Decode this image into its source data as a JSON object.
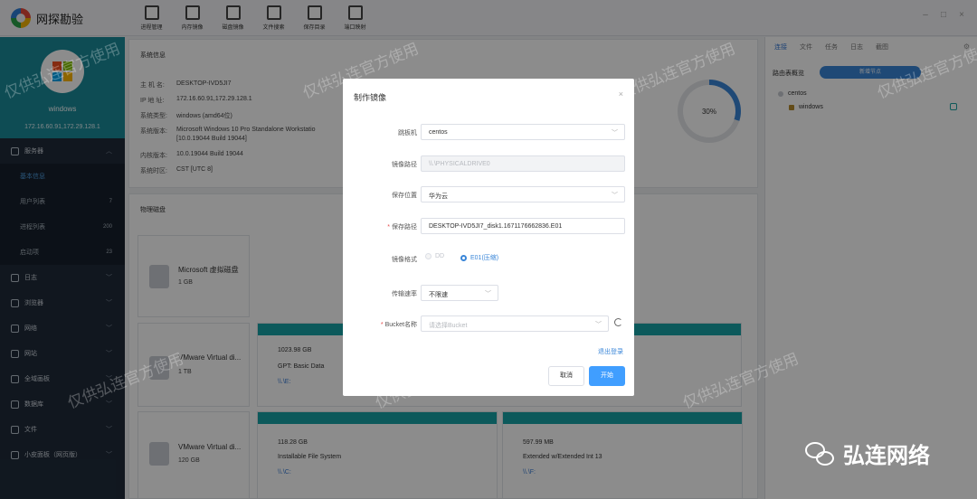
{
  "app": {
    "title": "网探勘验"
  },
  "toolbar": [
    {
      "label": "进程管理",
      "icon": "terminal-icon"
    },
    {
      "label": "内存镜像",
      "icon": "memory-icon"
    },
    {
      "label": "磁盘镜像",
      "icon": "disk-image-icon"
    },
    {
      "label": "文件搜索",
      "icon": "file-search-icon"
    },
    {
      "label": "保存目录",
      "icon": "folder-icon"
    },
    {
      "label": "端口映射",
      "icon": "port-map-icon"
    }
  ],
  "host": {
    "name": "windows",
    "ip": "172.16.60.91,172.29.128.1"
  },
  "sidebar": {
    "server": "服务器",
    "items": [
      {
        "label": "基本信息",
        "count": ""
      },
      {
        "label": "用户列表",
        "count": "7"
      },
      {
        "label": "进程列表",
        "count": "200"
      },
      {
        "label": "启动项",
        "count": "23"
      }
    ],
    "groups": [
      "日志",
      "浏览器",
      "网络",
      "网站",
      "全域画板",
      "数据库",
      "文件",
      "小皮面板（网页版）"
    ]
  },
  "system_info": {
    "title": "系统信息",
    "rows": [
      {
        "key": "主 机 名:",
        "value": "DESKTOP-IVD5JI7"
      },
      {
        "key": "IP 地 址:",
        "value": "172.16.60.91,172.29.128.1"
      },
      {
        "key": "系统类型:",
        "value": "windows (amd64位)"
      },
      {
        "key": "系统版本:",
        "value": "Microsoft Windows 10 Pro Standalone Workstatio"
      },
      {
        "key": "",
        "value": "[10.0.19044 Build 19044]"
      },
      {
        "key": "内核版本:",
        "value": "10.0.19044 Build 19044"
      },
      {
        "key": "系统时区:",
        "value": "CST [UTC 8]"
      }
    ],
    "usage_percent": 30,
    "usage_label": "30%"
  },
  "disks": {
    "title": "物理磁盘",
    "items": [
      {
        "name": "Microsoft 虚拟磁盘",
        "size": "1 GB"
      },
      {
        "name": "VMware Virtual di...",
        "size": "1 TB"
      },
      {
        "name": "VMware Virtual di...",
        "size": "120 GB"
      }
    ],
    "partitions": [
      {
        "size": "1023.98 GB",
        "type": "GPT: Basic Data",
        "path": "\\\\.\\E:"
      },
      {
        "size": "118.28 GB",
        "type": "Installable File System",
        "path": "\\\\.\\C:"
      },
      {
        "size": "597.99 MB",
        "type": "Extended w/Extended Int 13",
        "path": "\\\\.\\F:"
      }
    ]
  },
  "right_panel": {
    "tabs": [
      "连接",
      "文件",
      "任务",
      "日志",
      "截图"
    ],
    "routing_label": "路由表概览",
    "add_route": "新增节点",
    "tree": [
      "centos",
      "windows"
    ]
  },
  "dialog": {
    "title": "制作镜像",
    "springboard_label": "跳板机",
    "springboard_value": "centos",
    "image_path_label": "镜像路径",
    "image_path_value": "\\\\.\\PHYSICALDRIVE0",
    "save_location_label": "保存位置",
    "save_location_value": "华为云",
    "save_path_label": "保存路径",
    "save_path_value": "DESKTOP-IVD5JI7_disk1.1671176662836.E01",
    "format_label": "镜像格式",
    "format_options": [
      "DD",
      "E01(压缩)"
    ],
    "format_selected": "E01(压缩)",
    "speed_label": "传输速率",
    "speed_value": "不限速",
    "bucket_label": "Bucket名称",
    "bucket_placeholder": "请选择Bucket",
    "logout": "退出登录",
    "cancel": "取消",
    "start": "开始"
  },
  "watermark": "仅供弘连官方使用",
  "brand": "弘连网络"
}
